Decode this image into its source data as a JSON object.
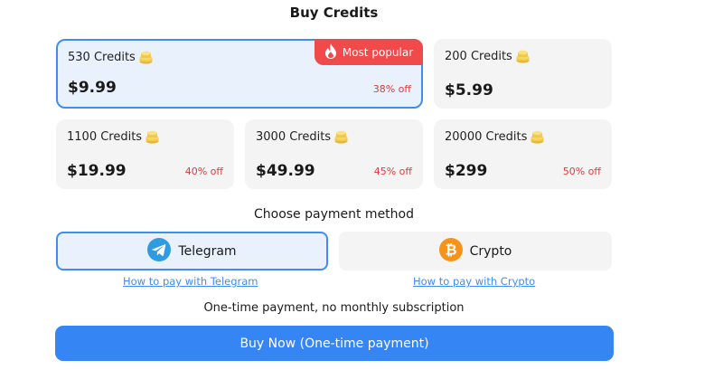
{
  "title": "Buy Credits",
  "packages": [
    {
      "credits": "530 Credits",
      "price": "$9.99",
      "discount": "38% off",
      "badge": "Most popular",
      "selected": true
    },
    {
      "credits": "200 Credits",
      "price": "$5.99",
      "discount": ""
    },
    {
      "credits": "1100 Credits",
      "price": "$19.99",
      "discount": "40% off"
    },
    {
      "credits": "3000 Credits",
      "price": "$49.99",
      "discount": "45% off"
    },
    {
      "credits": "20000 Credits",
      "price": "$299",
      "discount": "50% off"
    }
  ],
  "payment": {
    "title": "Choose payment method",
    "methods": [
      {
        "label": "Telegram",
        "icon": "telegram-icon",
        "help_link": "How to pay with Telegram",
        "selected": true
      },
      {
        "label": "Crypto",
        "icon": "bitcoin-icon",
        "help_link": "How to pay with Crypto"
      }
    ]
  },
  "note": "One-time payment, no monthly subscription",
  "buy_button": "Buy Now (One-time payment)",
  "colors": {
    "accent": "#3e8ef0",
    "badge": "#f04a4a",
    "discount": "#e23b3b",
    "buy": "#3585f5"
  }
}
